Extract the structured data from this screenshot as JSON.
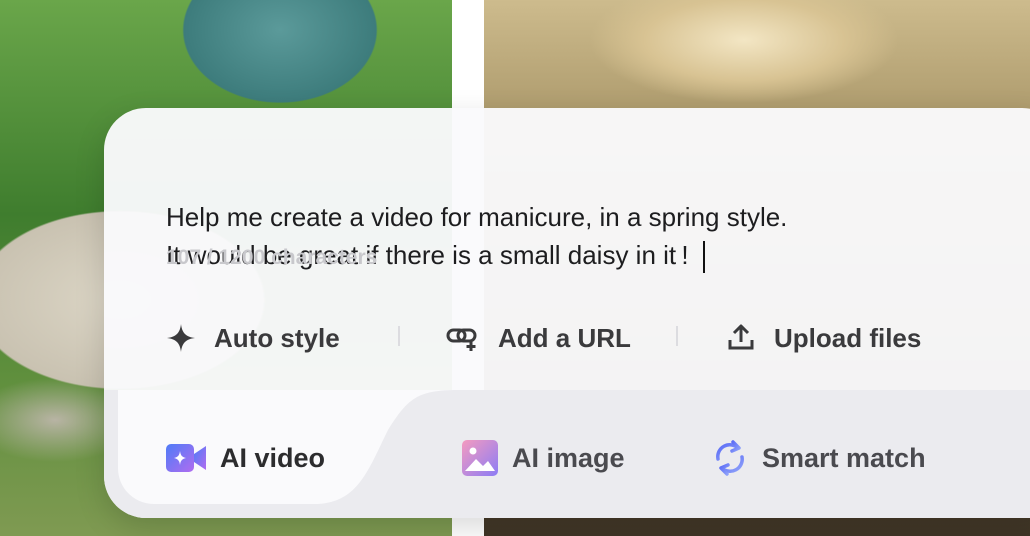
{
  "prompt": {
    "text": "Help me create a video for manicure, in a spring style.\n It would be great if there is a small daisy in it !",
    "counter": "107 / 1200 characters"
  },
  "tools": [
    {
      "label": "Auto style",
      "icon": "sparkle-icon"
    },
    {
      "label": "Add a URL",
      "icon": "link-icon"
    },
    {
      "label": "Upload files",
      "icon": "upload-icon"
    }
  ],
  "tabs": [
    {
      "label": "AI video",
      "icon": "video-camera-icon",
      "active": true
    },
    {
      "label": "AI image",
      "icon": "image-icon",
      "active": false
    },
    {
      "label": "Smart match",
      "icon": "sync-icon",
      "active": false
    }
  ],
  "colors": {
    "accent_start": "#5b6cf6",
    "accent_end": "#b06cf0",
    "image_icon_start": "#f08fb8",
    "image_icon_end": "#8c7cf5",
    "text": "#1d1d1f",
    "counter": "#c8c8cc"
  }
}
